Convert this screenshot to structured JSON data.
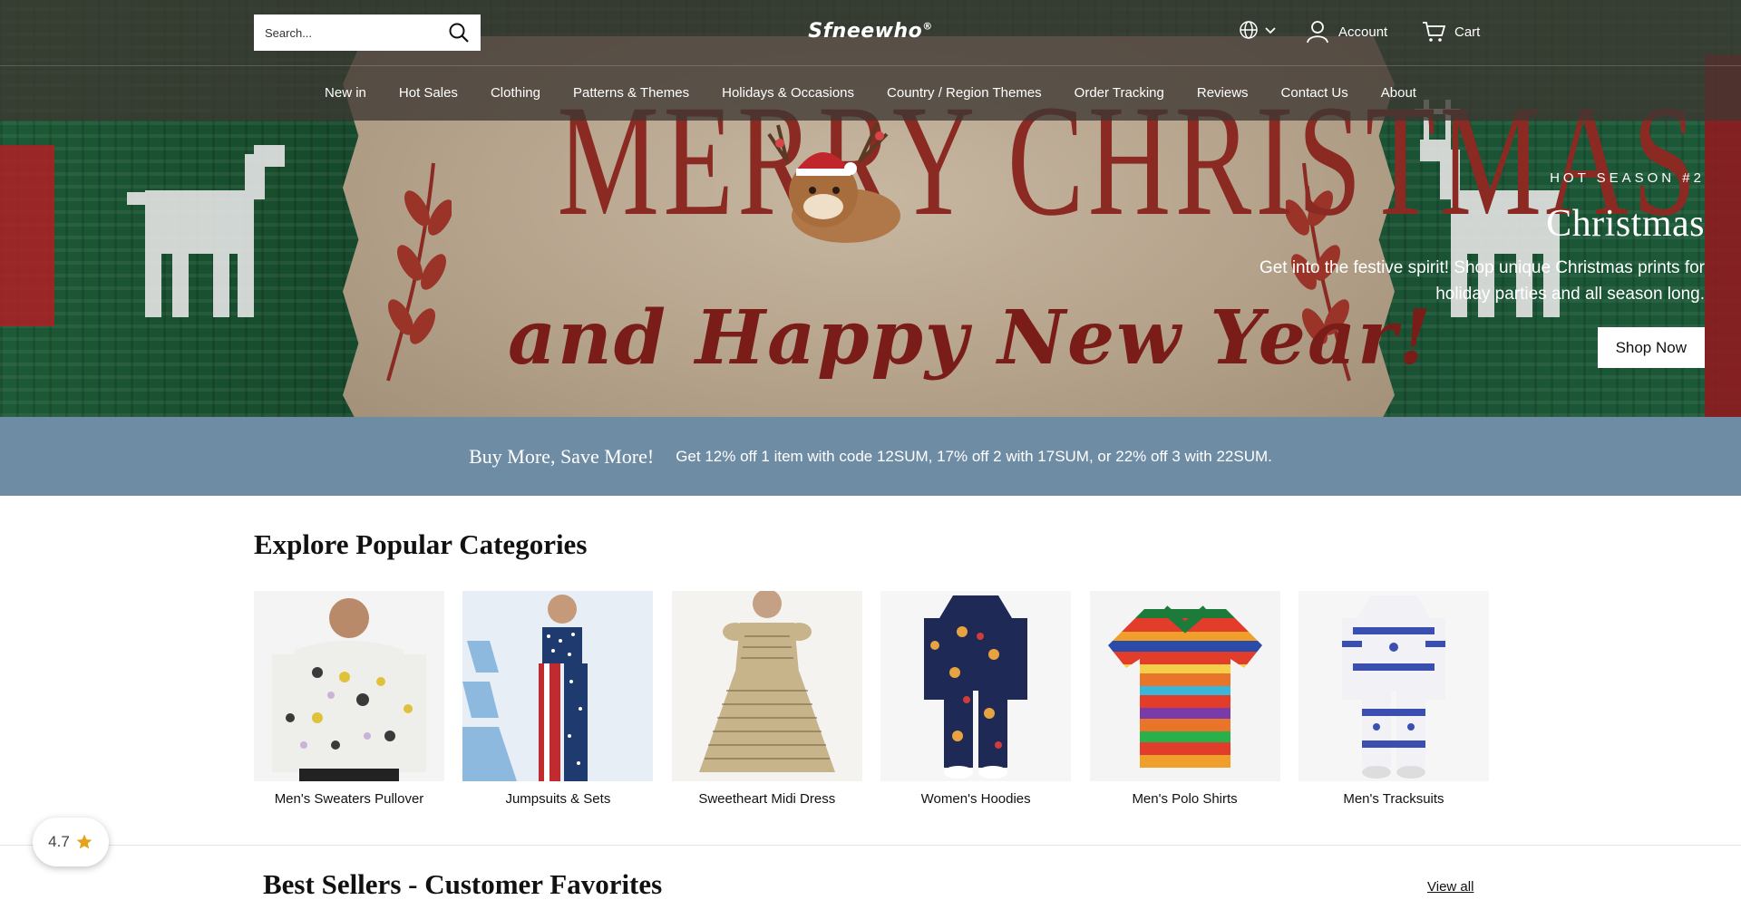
{
  "header": {
    "search_placeholder": "Search...",
    "logo": "Sfneewho",
    "logo_mark": "®",
    "account_label": "Account",
    "cart_label": "Cart"
  },
  "nav": {
    "items": [
      "New in",
      "Hot Sales",
      "Clothing",
      "Patterns & Themes",
      "Holidays & Occasions",
      "Country / Region Themes",
      "Order Tracking",
      "Reviews",
      "Contact Us",
      "About"
    ]
  },
  "hero": {
    "banner_line1": "MERRY CHRISTMAS",
    "banner_line2": "and Happy New Year!",
    "eyebrow": "HOT SEASON #2",
    "title": "Christmas",
    "text": "Get into the festive spirit! Shop unique Christmas prints for holiday parties and all season long.",
    "button": "Shop Now"
  },
  "promo": {
    "title": "Buy More, Save More!",
    "text": "Get 12% off 1 item with code 12SUM, 17% off 2 with 17SUM, or 22% off 3 with 22SUM."
  },
  "categories": {
    "title": "Explore Popular Categories",
    "items": [
      {
        "label": "Men's Sweaters Pullover",
        "icon": "floral-sweater-image"
      },
      {
        "label": "Jumpsuits & Sets",
        "icon": "flag-jumpsuit-image"
      },
      {
        "label": "Sweetheart Midi Dress",
        "icon": "constitution-dress-image"
      },
      {
        "label": "Women's Hoodies",
        "icon": "corgi-hoodie-set-image"
      },
      {
        "label": "Men's Polo Shirts",
        "icon": "serape-polo-image"
      },
      {
        "label": "Men's Tracksuits",
        "icon": "star-tracksuit-image"
      }
    ]
  },
  "best_sellers": {
    "title": "Best Sellers - Customer Favorites",
    "view_all": "View all"
  },
  "rating_widget": {
    "score": "4.7"
  },
  "colors": {
    "promo_bg": "#6f8ca5",
    "banner_red": "#8a2a22",
    "knit_green": "#1a5233",
    "star": "#e6a21a"
  }
}
